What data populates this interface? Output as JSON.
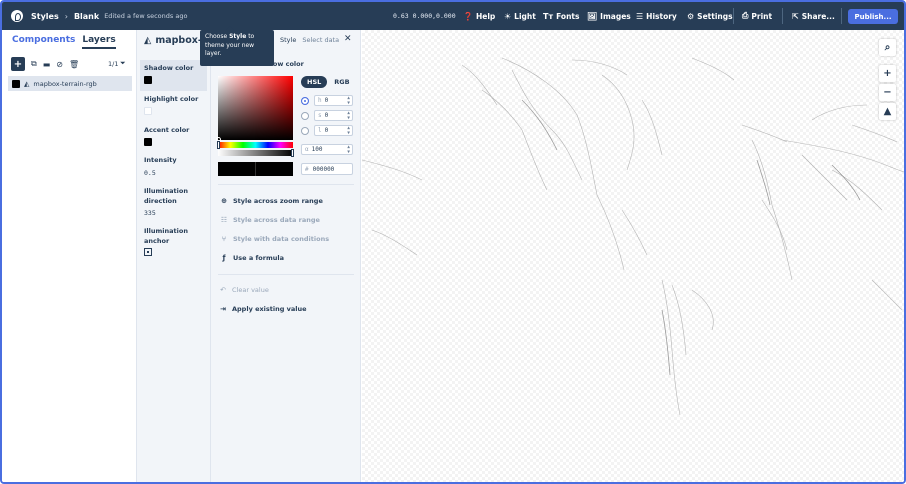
{
  "topbar": {
    "app_title": "Styles",
    "separator": "›",
    "style_name": "Blank",
    "edited_text": "Edited a few seconds ago",
    "coords": "0.63 0.000,0.000",
    "help_label": "Help",
    "light_label": "Light",
    "fonts_label": "Fonts",
    "images_label": "Images",
    "history_label": "History",
    "settings_label": "Settings",
    "print_label": "Print",
    "share_label": "Share...",
    "publish_label": "Publish..."
  },
  "left_panel": {
    "tab_components": "Components",
    "tab_layers": "Layers",
    "layer_count": "1/1",
    "layers": [
      {
        "name": "mapbox-terrain-rgb",
        "swatch_color": "#000000"
      }
    ]
  },
  "properties": {
    "title": "mapbox-t",
    "items": [
      {
        "label": "Shadow color",
        "kind": "color",
        "color": "#000000"
      },
      {
        "label": "Highlight color",
        "kind": "color",
        "color": "#ffffff"
      },
      {
        "label": "Accent color",
        "kind": "color",
        "color": "#000000"
      },
      {
        "label": "Intensity",
        "kind": "value",
        "value": "0.5"
      },
      {
        "label": "Illumination direction",
        "kind": "value",
        "value": "335"
      },
      {
        "label": "Illumination anchor",
        "kind": "icon",
        "icon": "anchor-viewport-icon"
      }
    ]
  },
  "tooltip": {
    "prefix": "Choose ",
    "bold": "Style",
    "suffix": " to theme your new layer."
  },
  "editor": {
    "tab_style": "Style",
    "tab_data": "Select data",
    "heading": "Hillshade shadow color",
    "mode_hsl": "HSL",
    "mode_rgb": "RGB",
    "h_prefix": "h",
    "h_value": "0",
    "s_prefix": "s",
    "s_value": "0",
    "l_prefix": "l",
    "l_value": "0",
    "alpha_prefix": "α",
    "alpha_value": "100",
    "hex_prefix": "#",
    "hex_value": "000000",
    "options": [
      {
        "label": "Style across zoom range",
        "icon": "zoom-range-icon",
        "enabled": true
      },
      {
        "label": "Style across data range",
        "icon": "data-range-icon",
        "enabled": false
      },
      {
        "label": "Style with data conditions",
        "icon": "data-conditions-icon",
        "enabled": false
      },
      {
        "label": "Use a formula",
        "icon": "formula-icon",
        "enabled": true
      }
    ],
    "clear_value": "Clear value",
    "apply_existing": "Apply existing value"
  },
  "colors": {
    "topbar_bg": "#273d56",
    "accent": "#4a6ee0",
    "panel_bg": "#f2f5f9"
  }
}
